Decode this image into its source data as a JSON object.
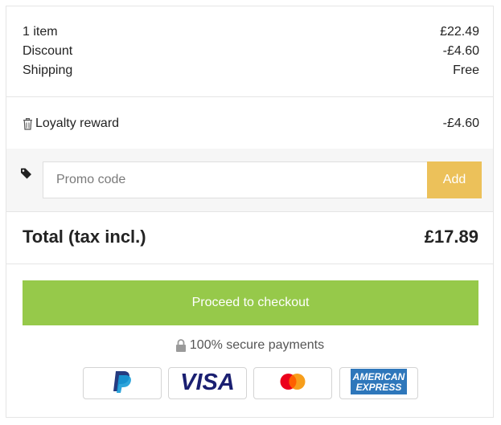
{
  "summary": {
    "items": [
      {
        "label": "1 item",
        "value": "£22.49"
      },
      {
        "label": "Discount",
        "value": "-£4.60"
      },
      {
        "label": "Shipping",
        "value": "Free"
      }
    ]
  },
  "loyalty": {
    "label": "Loyalty reward",
    "value": "-£4.60",
    "icon": "trash-icon"
  },
  "promo": {
    "placeholder": "Promo code",
    "value": "",
    "button_label": "Add",
    "icon": "tag-icon"
  },
  "total": {
    "label": "Total (tax incl.)",
    "value": "£17.89"
  },
  "checkout": {
    "label": "Proceed to checkout"
  },
  "secure": {
    "text": "100% secure payments",
    "icon": "lock-icon"
  },
  "payment_methods": [
    {
      "name": "PayPal",
      "icon": "paypal-icon"
    },
    {
      "name": "VISA",
      "icon": "visa-icon"
    },
    {
      "name": "Mastercard",
      "icon": "mastercard-icon"
    },
    {
      "name": "American Express",
      "icon": "amex-icon",
      "text_lines": [
        "AMERICAN",
        "EXPRESS"
      ]
    }
  ],
  "colors": {
    "accent_add": "#ecc15a",
    "checkout": "#96c94a",
    "text": "#232323",
    "visa": "#1a1f71",
    "amex": "#2e77bb"
  }
}
